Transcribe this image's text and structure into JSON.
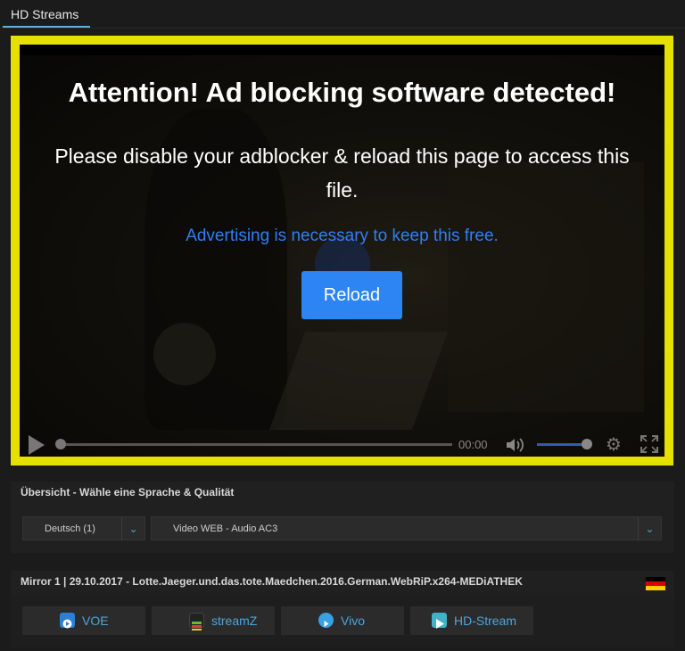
{
  "tabs": [
    {
      "label": "HD Streams"
    }
  ],
  "player": {
    "headline": "Attention! Ad blocking software detected!",
    "message": "Please disable your adblocker & reload this page to access this file.",
    "note": "Advertising is necessary to keep this free.",
    "reload_label": "Reload",
    "time": "00:00"
  },
  "overview": {
    "title": "Übersicht - Wähle eine Sprache & Qualität",
    "language_select": "Deutsch (1)",
    "quality_select": "Video WEB - Audio AC3"
  },
  "mirror": {
    "title": "Mirror 1 | 29.10.2017 - Lotte.Jaeger.und.das.tote.Maedchen.2016.German.WebRiP.x264-MEDiATHEK",
    "hosts": [
      {
        "label": "VOE",
        "icon": "voe-icon",
        "color": "#2d7fd4"
      },
      {
        "label": "streamZ",
        "icon": "streamz-icon",
        "color": "#3a6b2e"
      },
      {
        "label": "Vivo",
        "icon": "vivo-icon",
        "color": "#3aa0e0"
      },
      {
        "label": "HD-Stream",
        "icon": "hdstream-icon",
        "color": "#3fb2c8"
      }
    ]
  }
}
